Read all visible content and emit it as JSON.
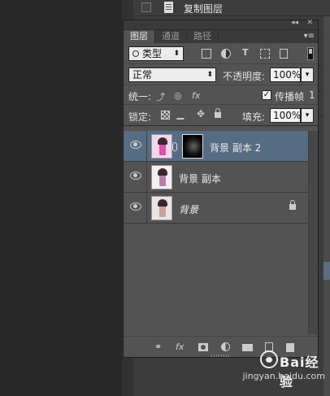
{
  "top_row": {
    "label": "复制图层"
  },
  "panel": {
    "collapse_icon": "double-arrow-icon",
    "close_icon": "close-icon",
    "tabs": [
      {
        "label": "图层",
        "active": true
      },
      {
        "label": "通道",
        "active": false
      },
      {
        "label": "路径",
        "active": false
      }
    ],
    "menu_icon": "panel-menu-icon"
  },
  "filter": {
    "kind_value": "类型",
    "icons": [
      "image-filter-icon",
      "adjustment-filter-icon",
      "text-filter-icon",
      "shape-filter-icon",
      "smart-object-filter-icon",
      "filter-toggle-icon"
    ]
  },
  "blend": {
    "mode": "正常",
    "opacity_label": "不透明度:",
    "opacity_value": "100%"
  },
  "unify": {
    "label": "统一:",
    "propagate_label": "传播帧",
    "propagate_checked": true,
    "frame": "1"
  },
  "lock": {
    "label": "锁定:",
    "fill_label": "填充:",
    "fill_value": "100%"
  },
  "layers": [
    {
      "name": "背景 副本 2",
      "selected": true,
      "has_mask": true,
      "visible": true,
      "locked": false
    },
    {
      "name": "背景 副本",
      "selected": false,
      "has_mask": false,
      "visible": true,
      "locked": false
    },
    {
      "name": "背景",
      "selected": false,
      "has_mask": false,
      "visible": true,
      "locked": true
    }
  ],
  "bottom_bar": {
    "link_icon": "link-icon",
    "fx_label": "fx",
    "mask_icon": "add-mask-icon",
    "adjustment_icon": "adjustment-layer-icon",
    "group_icon": "group-folder-icon",
    "new_layer_icon": "new-layer-icon",
    "delete_icon": "trash-icon"
  },
  "watermark": {
    "brand": "Bai经验",
    "url": "jingyan.baidu.com"
  }
}
